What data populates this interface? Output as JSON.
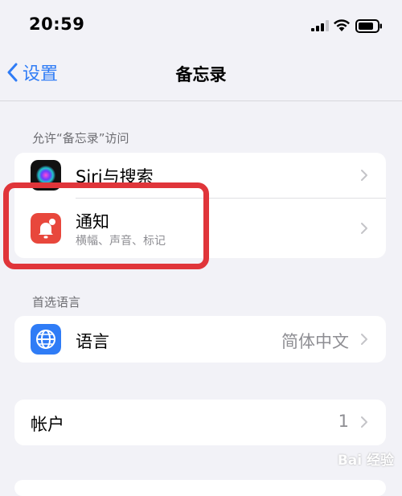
{
  "status_bar": {
    "time": "20:59"
  },
  "nav": {
    "back_label": "设置",
    "title": "备忘录"
  },
  "section_access": {
    "header": "允许“备忘录”访问",
    "rows": [
      {
        "label": "Siri与搜索",
        "icon": "siri-icon"
      },
      {
        "label": "通知",
        "subtitle": "横幅、声音、标记",
        "icon": "notification-bell-icon"
      }
    ]
  },
  "section_language": {
    "header": "首选语言",
    "row": {
      "label": "语言",
      "value": "简体中文",
      "icon": "globe-icon"
    }
  },
  "section_accounts": {
    "row": {
      "label": "帐户",
      "value": "1"
    }
  },
  "watermark": {
    "text": "Bai 经验"
  },
  "colors": {
    "accent": "#2f7cf6",
    "notification": "#e8473c",
    "highlight": "#e0353a",
    "language": "#2f7cf6"
  }
}
